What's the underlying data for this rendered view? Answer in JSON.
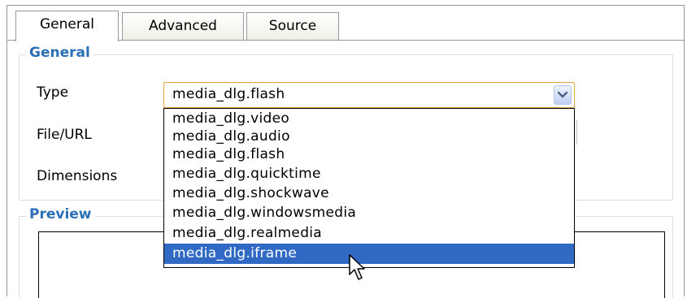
{
  "tabs": [
    {
      "label": "General",
      "active": true
    },
    {
      "label": "Advanced",
      "active": false
    },
    {
      "label": "Source",
      "active": false
    }
  ],
  "general": {
    "legend": "General",
    "type_label": "Type",
    "file_label": "File/URL",
    "dimensions_label": "Dimensions",
    "type_value": "media_dlg.flash"
  },
  "dropdown": {
    "options": [
      "media_dlg.video",
      "media_dlg.audio",
      "media_dlg.flash",
      "media_dlg.quicktime",
      "media_dlg.shockwave",
      "media_dlg.windowsmedia",
      "media_dlg.realmedia",
      "media_dlg.iframe"
    ],
    "highlighted": "media_dlg.iframe"
  },
  "preview": {
    "legend": "Preview"
  },
  "icons": {
    "select_arrow": "chevron-down-icon",
    "cursor": "mouse-pointer-icon"
  },
  "colors": {
    "legend": "#2b6fb6",
    "selection": "#316ac5",
    "focus_border": "#e3a33a"
  }
}
